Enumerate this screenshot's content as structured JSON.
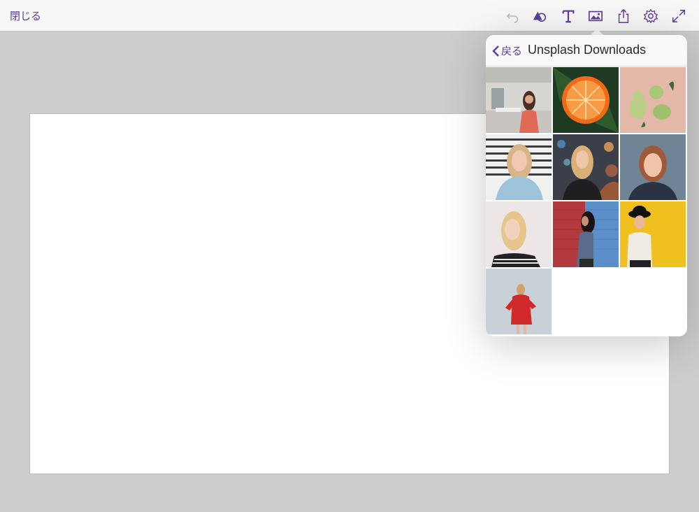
{
  "toolbar": {
    "close_label": "閉じる",
    "icons": [
      "undo-icon",
      "shapes-icon",
      "text-icon",
      "image-icon",
      "share-icon",
      "settings-icon",
      "fullscreen-icon"
    ],
    "accent_color": "#5d3d9c"
  },
  "popover": {
    "back_label": "戻る",
    "title": "Unsplash Downloads",
    "photos": [
      {
        "subject": "woman in office"
      },
      {
        "subject": "sliced orange"
      },
      {
        "subject": "pears"
      },
      {
        "subject": "woman in blue sweater"
      },
      {
        "subject": "woman with bokeh lights"
      },
      {
        "subject": "red-haired woman portrait"
      },
      {
        "subject": "blonde woman in striped top"
      },
      {
        "subject": "woman by brick wall"
      },
      {
        "subject": "woman with black hat on yellow"
      },
      {
        "subject": "woman in red sweatshirt"
      }
    ]
  }
}
